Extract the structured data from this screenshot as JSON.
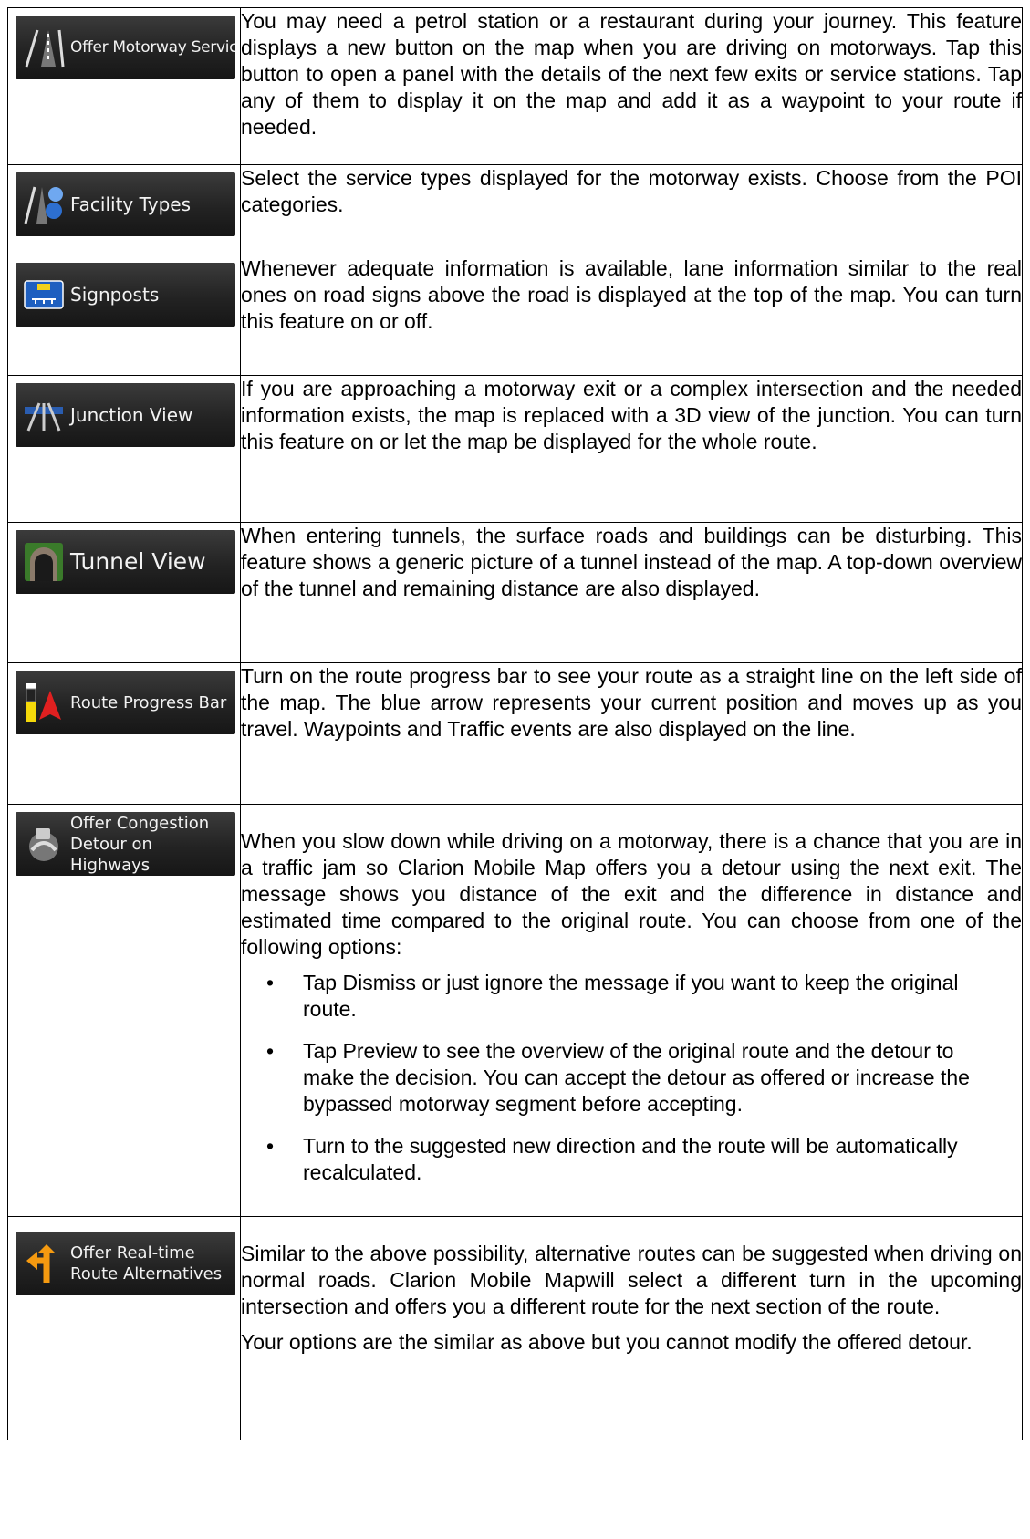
{
  "rows": [
    {
      "button": "Offer Motorway Services",
      "icon": "motorway-road-icon",
      "text": "You may need a petrol station or a restaurant during your journey. This feature displays a new button on the map when you are driving on motorways. Tap this button to open a panel with the details of the next few exits or service stations. Tap any of them to display it on the map and add it as a waypoint to your route if needed."
    },
    {
      "button": "Facility Types",
      "icon": "motorway-pins-icon",
      "text": "Select the service types displayed for the motorway exists. Choose from the POI categories."
    },
    {
      "button": "Signposts",
      "icon": "signpost-icon",
      "text": "Whenever adequate information is available, lane information similar to the real ones on road signs above the road is displayed at the top of the map. You can turn this feature on or off."
    },
    {
      "button": "Junction View",
      "icon": "junction-icon",
      "text": "If you are approaching a motorway exit or a complex intersection and the needed information exists, the map is replaced with a 3D view of the junction. You can turn this feature on or let the map be displayed for the whole route."
    },
    {
      "button": "Tunnel View",
      "icon": "tunnel-icon",
      "text": "When entering tunnels, the surface roads and buildings can be disturbing. This feature shows a generic picture of a tunnel instead of the map. A top-down overview of the tunnel and remaining distance are also displayed."
    },
    {
      "button": "Route Progress Bar",
      "icon": "progress-bar-icon",
      "text": "Turn on the route progress bar to see your route as a straight line on the left side of the map. The blue arrow represents your current position and moves up as you travel. Waypoints and Traffic events are also displayed on the line."
    },
    {
      "button": "Offer Congestion Detour on Highways",
      "icon": "congestion-icon",
      "text": "When you slow down while driving on a motorway, there is a chance that you are in a traffic jam so Clarion Mobile Map offers you a detour using the next exit. The message shows you distance of the exit and the difference in distance and estimated time compared to the original route. You can choose from one of the following options:",
      "options": [
        "Tap Dismiss or just ignore the message if you want to keep the original route.",
        "Tap Preview to see the overview of the original route and the detour to make the decision. You can accept the detour as offered or increase the bypassed motorway segment before accepting.",
        "Turn to the suggested new direction and the route will be automatically recalculated."
      ]
    },
    {
      "button": "Offer Real-time Route Alternatives",
      "icon": "alternative-route-icon",
      "text": "Similar to the above possibility, alternative routes can be suggested when driving on normal roads. Clarion Mobile Mapwill select a different turn in the upcoming intersection and offers you a different route for the next section of the route.",
      "text2": "Your options are the similar as above but you cannot modify the offered detour."
    }
  ]
}
